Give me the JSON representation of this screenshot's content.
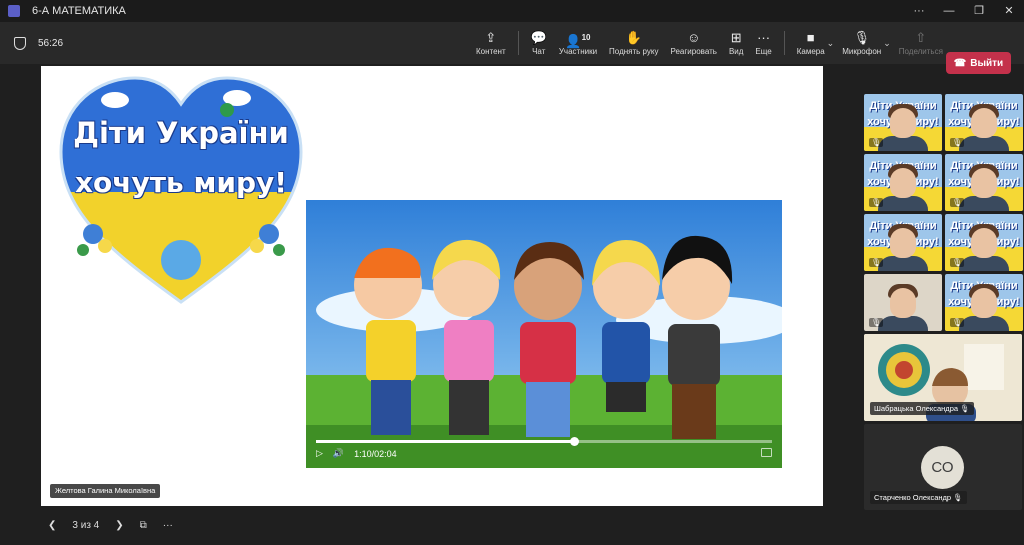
{
  "window": {
    "title": "6-А МАТЕМАТИКА",
    "controls": [
      "···",
      "—",
      "❐",
      "✕"
    ]
  },
  "toolbar": {
    "timer": "56:26",
    "tools": [
      {
        "label": "Контент",
        "icon": "share-screen-icon",
        "glyph": "⇪"
      },
      {
        "label": "Чат",
        "icon": "chat-icon",
        "glyph": "💬"
      },
      {
        "label": "Участники",
        "icon": "participants-icon",
        "glyph": "👤",
        "count": "10"
      },
      {
        "label": "Поднять руку",
        "icon": "raise-hand-icon",
        "glyph": "✋"
      },
      {
        "label": "Реагировать",
        "icon": "react-icon",
        "glyph": "☺"
      },
      {
        "label": "Вид",
        "icon": "view-icon",
        "glyph": "⊞"
      },
      {
        "label": "Еще",
        "icon": "more-icon",
        "glyph": "···"
      }
    ],
    "camera": {
      "label": "Камера",
      "glyph": "■"
    },
    "mic": {
      "label": "Микрофон",
      "glyph": "🎙"
    },
    "share": {
      "label": "Поделиться",
      "glyph": "⇧"
    },
    "leave_label": "Выйти",
    "leave_color": "#c4314b"
  },
  "slide": {
    "heart_line1": "Діти України",
    "heart_line2": "хочуть миру!",
    "video": {
      "time": "1:10/02:04",
      "progress": 0.565
    },
    "presenter": "Желтова Галина Миколаївна"
  },
  "slide_nav": {
    "position": "3 из 4"
  },
  "participants": {
    "tile_text_1": "Діти України",
    "tile_text_2": "хочуть миру!",
    "big_tile_name": "Шабрацька Олександра",
    "co_initials": "СО",
    "co_name": "Старченко Олександр"
  }
}
